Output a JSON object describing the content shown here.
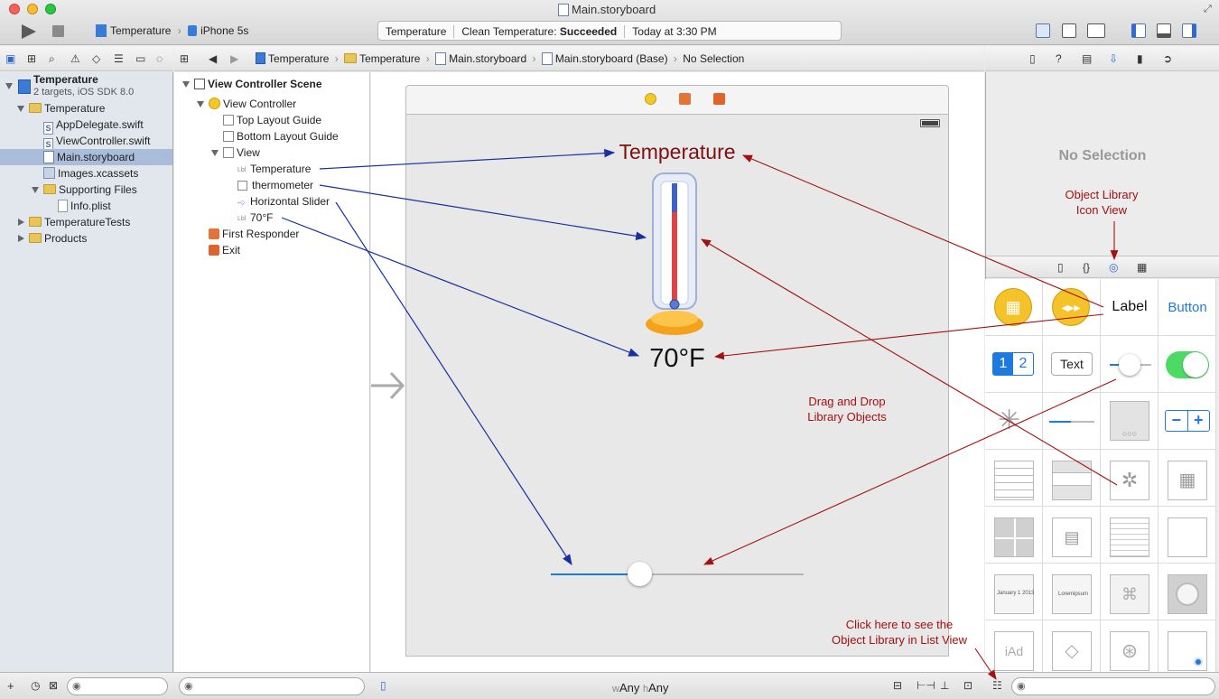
{
  "window": {
    "title": "Main.storyboard"
  },
  "toolbar": {
    "scheme": "Temperature",
    "device": "iPhone 5s",
    "status_app": "Temperature",
    "status_action": "Clean Temperature:",
    "status_result": "Succeeded",
    "status_time": "Today at 3:30 PM"
  },
  "jumpbar": {
    "crumbs": [
      "Temperature",
      "Temperature",
      "Main.storyboard",
      "Main.storyboard (Base)",
      "No Selection"
    ]
  },
  "navigator": {
    "project_name": "Temperature",
    "project_sub": "2 targets, iOS SDK 8.0",
    "items": [
      "Temperature",
      "AppDelegate.swift",
      "ViewController.swift",
      "Main.storyboard",
      "Images.xcassets",
      "Supporting Files",
      "Info.plist",
      "TemperatureTests",
      "Products"
    ]
  },
  "outline": {
    "scene": "View Controller Scene",
    "items": [
      "View Controller",
      "Top Layout Guide",
      "Bottom Layout Guide",
      "View",
      "Temperature",
      "thermometer",
      "Horizontal Slider",
      "70°F",
      "First Responder",
      "Exit"
    ],
    "lbl_tag": "Lbl"
  },
  "canvas": {
    "title_label": "Temperature",
    "temp_label": "70°F",
    "slider_value": 0.35,
    "size_w": "w",
    "size_any1": "Any",
    "size_h": "h",
    "size_any2": "Any"
  },
  "inspector": {
    "empty": "No Selection"
  },
  "library": {
    "label_item": "Label",
    "button_item": "Button",
    "seg1": "1",
    "seg2": "2",
    "text_item": "Text",
    "iad": "iAd",
    "cal_month": "January",
    "cal_day": "1",
    "cal_year": "2013",
    "lorem": "Loremipsum"
  },
  "annotations": {
    "icon_view_line1": "Object Library",
    "icon_view_line2": "Icon View",
    "drag_line1": "Drag and Drop",
    "drag_line2": "Library Objects",
    "list_line1": "Click here to see the",
    "list_line2": "Object Library in List View"
  },
  "colors": {
    "annotation": "#a50f0f",
    "arrow_blue": "#1a2fa0",
    "accent": "#1f7ae0",
    "switch_on": "#4cd964"
  }
}
